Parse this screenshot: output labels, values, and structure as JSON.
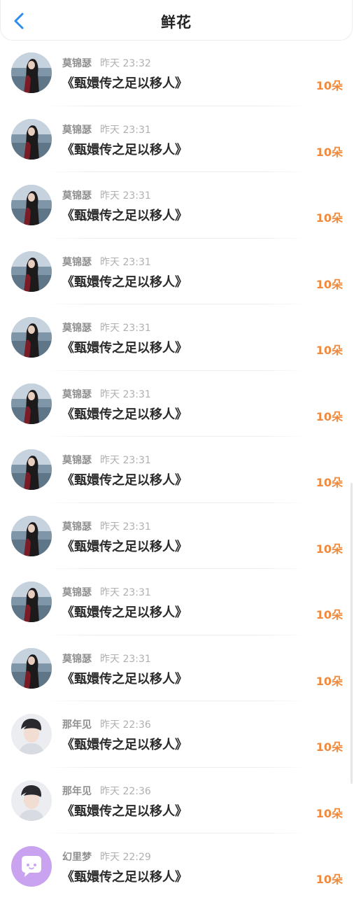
{
  "header": {
    "title": "鲜花"
  },
  "colors": {
    "accent": "#2d8cf0",
    "count": "#f08a3e",
    "avatar_purple": "#c9a3ef"
  },
  "items": [
    {
      "avatar": "dark-hair-girl-avatar",
      "name": "莫锦瑟",
      "time": "昨天 23:32",
      "content": "《甄嬛传之足以移人》",
      "count": "10朵"
    },
    {
      "avatar": "dark-hair-girl-avatar",
      "name": "莫锦瑟",
      "time": "昨天 23:31",
      "content": "《甄嬛传之足以移人》",
      "count": "10朵"
    },
    {
      "avatar": "dark-hair-girl-avatar",
      "name": "莫锦瑟",
      "time": "昨天 23:31",
      "content": "《甄嬛传之足以移人》",
      "count": "10朵"
    },
    {
      "avatar": "dark-hair-girl-avatar",
      "name": "莫锦瑟",
      "time": "昨天 23:31",
      "content": "《甄嬛传之足以移人》",
      "count": "10朵"
    },
    {
      "avatar": "dark-hair-girl-avatar",
      "name": "莫锦瑟",
      "time": "昨天 23:31",
      "content": "《甄嬛传之足以移人》",
      "count": "10朵"
    },
    {
      "avatar": "dark-hair-girl-avatar",
      "name": "莫锦瑟",
      "time": "昨天 23:31",
      "content": "《甄嬛传之足以移人》",
      "count": "10朵"
    },
    {
      "avatar": "dark-hair-girl-avatar",
      "name": "莫锦瑟",
      "time": "昨天 23:31",
      "content": "《甄嬛传之足以移人》",
      "count": "10朵"
    },
    {
      "avatar": "dark-hair-girl-avatar",
      "name": "莫锦瑟",
      "time": "昨天 23:31",
      "content": "《甄嬛传之足以移人》",
      "count": "10朵"
    },
    {
      "avatar": "dark-hair-girl-avatar",
      "name": "莫锦瑟",
      "time": "昨天 23:31",
      "content": "《甄嬛传之足以移人》",
      "count": "10朵"
    },
    {
      "avatar": "dark-hair-girl-avatar",
      "name": "莫锦瑟",
      "time": "昨天 23:31",
      "content": "《甄嬛传之足以移人》",
      "count": "10朵"
    },
    {
      "avatar": "young-man-avatar",
      "name": "那年见",
      "time": "昨天 22:36",
      "content": "《甄嬛传之足以移人》",
      "count": "10朵"
    },
    {
      "avatar": "young-man-avatar",
      "name": "那年见",
      "time": "昨天 22:36",
      "content": "《甄嬛传之足以移人》",
      "count": "10朵"
    },
    {
      "avatar": "chat-bubble-avatar",
      "name": "幻里梦",
      "time": "昨天 22:29",
      "content": "《甄嬛传之足以移人》",
      "count": "10朵"
    }
  ]
}
